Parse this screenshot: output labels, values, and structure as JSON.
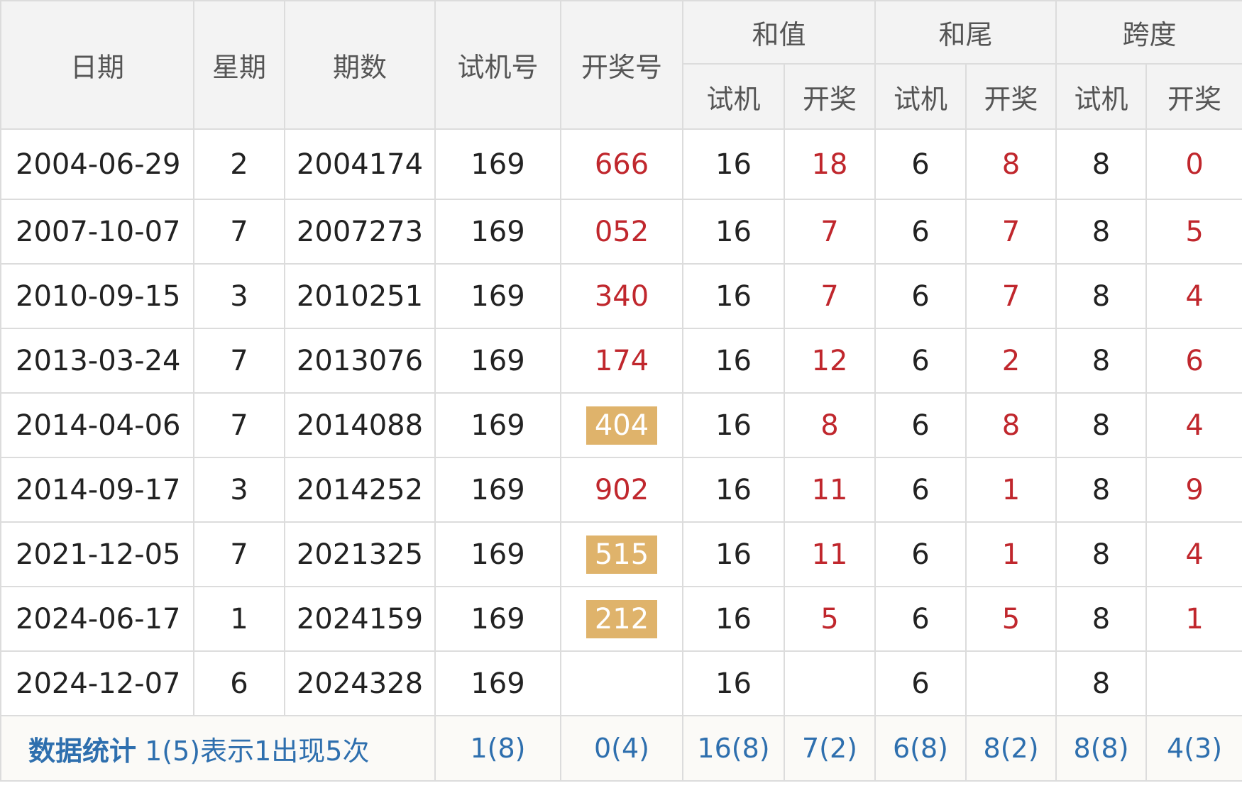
{
  "headers": {
    "date": "日期",
    "weekday": "星期",
    "issue": "期数",
    "test_number": "试机号",
    "draw_number": "开奖号",
    "sum": "和值",
    "sum_tail": "和尾",
    "span": "跨度",
    "sub_test": "试机",
    "sub_draw": "开奖"
  },
  "rows": [
    {
      "date": "2004-06-29",
      "weekday": "2",
      "issue": "2004174",
      "test": "169",
      "draw": "666",
      "draw_highlight": false,
      "sum_test": "16",
      "sum_draw": "18",
      "tail_test": "6",
      "tail_draw": "8",
      "span_test": "8",
      "span_draw": "0"
    },
    {
      "date": "2007-10-07",
      "weekday": "7",
      "issue": "2007273",
      "test": "169",
      "draw": "052",
      "draw_highlight": false,
      "sum_test": "16",
      "sum_draw": "7",
      "tail_test": "6",
      "tail_draw": "7",
      "span_test": "8",
      "span_draw": "5"
    },
    {
      "date": "2010-09-15",
      "weekday": "3",
      "issue": "2010251",
      "test": "169",
      "draw": "340",
      "draw_highlight": false,
      "sum_test": "16",
      "sum_draw": "7",
      "tail_test": "6",
      "tail_draw": "7",
      "span_test": "8",
      "span_draw": "4"
    },
    {
      "date": "2013-03-24",
      "weekday": "7",
      "issue": "2013076",
      "test": "169",
      "draw": "174",
      "draw_highlight": false,
      "sum_test": "16",
      "sum_draw": "12",
      "tail_test": "6",
      "tail_draw": "2",
      "span_test": "8",
      "span_draw": "6"
    },
    {
      "date": "2014-04-06",
      "weekday": "7",
      "issue": "2014088",
      "test": "169",
      "draw": "404",
      "draw_highlight": true,
      "sum_test": "16",
      "sum_draw": "8",
      "tail_test": "6",
      "tail_draw": "8",
      "span_test": "8",
      "span_draw": "4"
    },
    {
      "date": "2014-09-17",
      "weekday": "3",
      "issue": "2014252",
      "test": "169",
      "draw": "902",
      "draw_highlight": false,
      "sum_test": "16",
      "sum_draw": "11",
      "tail_test": "6",
      "tail_draw": "1",
      "span_test": "8",
      "span_draw": "9"
    },
    {
      "date": "2021-12-05",
      "weekday": "7",
      "issue": "2021325",
      "test": "169",
      "draw": "515",
      "draw_highlight": true,
      "sum_test": "16",
      "sum_draw": "11",
      "tail_test": "6",
      "tail_draw": "1",
      "span_test": "8",
      "span_draw": "4"
    },
    {
      "date": "2024-06-17",
      "weekday": "1",
      "issue": "2024159",
      "test": "169",
      "draw": "212",
      "draw_highlight": true,
      "sum_test": "16",
      "sum_draw": "5",
      "tail_test": "6",
      "tail_draw": "5",
      "span_test": "8",
      "span_draw": "1"
    },
    {
      "date": "2024-12-07",
      "weekday": "6",
      "issue": "2024328",
      "test": "169",
      "draw": "",
      "draw_highlight": false,
      "sum_test": "16",
      "sum_draw": "",
      "tail_test": "6",
      "tail_draw": "",
      "span_test": "8",
      "span_draw": ""
    }
  ],
  "stats": {
    "label": "数据统计",
    "note": "1(5)表示1出现5次",
    "test": "1(8)",
    "draw": "0(4)",
    "sum_test": "16(8)",
    "sum_draw": "7(2)",
    "tail_test": "6(8)",
    "tail_draw": "8(2)",
    "span_test": "8(8)",
    "span_draw": "4(3)"
  },
  "colors": {
    "draw_red": "#c0272d",
    "highlight_bg": "#dfb36b",
    "stats_blue": "#2e6fae",
    "header_bg": "#f3f3f3",
    "border": "#dcdcdc"
  }
}
